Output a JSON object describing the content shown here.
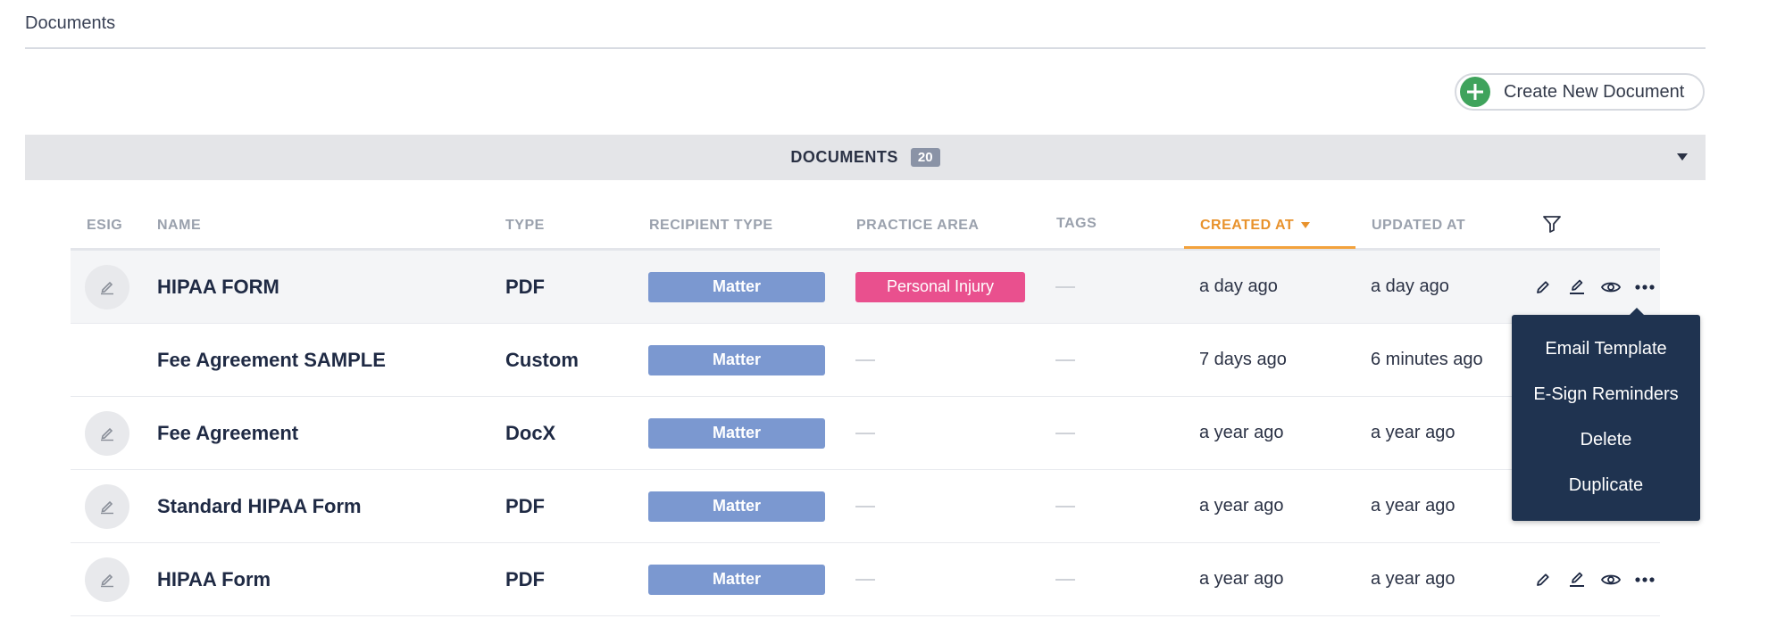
{
  "breadcrumb": "Documents",
  "create_button": {
    "label": "Create New Document"
  },
  "section": {
    "title": "DOCUMENTS",
    "count": "20"
  },
  "columns": {
    "esig": "ESIG",
    "name": "NAME",
    "type": "TYPE",
    "recipient_type": "RECIPIENT TYPE",
    "practice_area": "PRACTICE AREA",
    "tags": "TAGS",
    "created_at": "CREATED AT",
    "updated_at": "UPDATED AT"
  },
  "rows": [
    {
      "name": "HIPAA FORM",
      "type": "PDF",
      "recipient_type": "Matter",
      "practice_area": "Personal Injury",
      "created_at": "a day ago",
      "updated_at": "a day ago"
    },
    {
      "name": "Fee Agreement SAMPLE",
      "type": "Custom",
      "recipient_type": "Matter",
      "practice_area": "",
      "created_at": "7 days ago",
      "updated_at": "6 minutes ago"
    },
    {
      "name": "Fee Agreement",
      "type": "DocX",
      "recipient_type": "Matter",
      "practice_area": "",
      "created_at": "a year ago",
      "updated_at": "a year ago"
    },
    {
      "name": "Standard HIPAA Form",
      "type": "PDF",
      "recipient_type": "Matter",
      "practice_area": "",
      "created_at": "a year ago",
      "updated_at": "a year ago"
    },
    {
      "name": "HIPAA Form",
      "type": "PDF",
      "recipient_type": "Matter",
      "practice_area": "",
      "created_at": "a year ago",
      "updated_at": "a year ago"
    }
  ],
  "menu": {
    "items": [
      "Email Template",
      "E-Sign Reminders",
      "Delete",
      "Duplicate"
    ]
  },
  "colors": {
    "matter_badge": "#7b98d0",
    "practice_area_badge": "#e9508e",
    "active_sort": "#e8922c",
    "create_plus": "#3fa35c",
    "menu_bg": "#1f3350"
  }
}
